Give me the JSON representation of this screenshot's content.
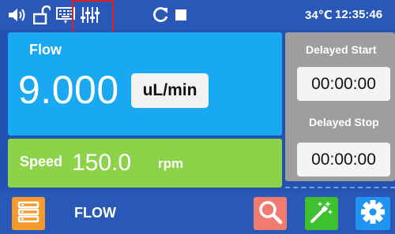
{
  "status_bar": {
    "icons": [
      "speaker-icon",
      "unlock-icon",
      "keyboard-icon",
      "equalizer-icon",
      "refresh-icon",
      "stop-icon"
    ],
    "temperature": "34℃",
    "time": "12:35:46",
    "highlight_color": "#e02020"
  },
  "flow": {
    "label": "Flow",
    "value": "9.000",
    "unit": "uL/min"
  },
  "speed": {
    "label": "Speed",
    "value": "150.0",
    "unit": "rpm"
  },
  "delay": {
    "start_label": "Delayed Start",
    "start_time": "00:00:00",
    "stop_label": "Delayed Stop",
    "stop_time": "00:00:00"
  },
  "bottom_bar": {
    "mode_label": "FLOW",
    "buttons": [
      "menu-icon",
      "search-icon",
      "magic-wand-icon",
      "gear-icon"
    ]
  },
  "colors": {
    "background": "#2452b0",
    "flow_panel": "#18a9f2",
    "speed_panel": "#8dd34a",
    "delay_panel": "#9e9e9e",
    "menu_button": "#f59a2c",
    "search_button": "#f07b70",
    "wizard_button": "#3ec12f",
    "settings_button": "#1f94f0"
  }
}
